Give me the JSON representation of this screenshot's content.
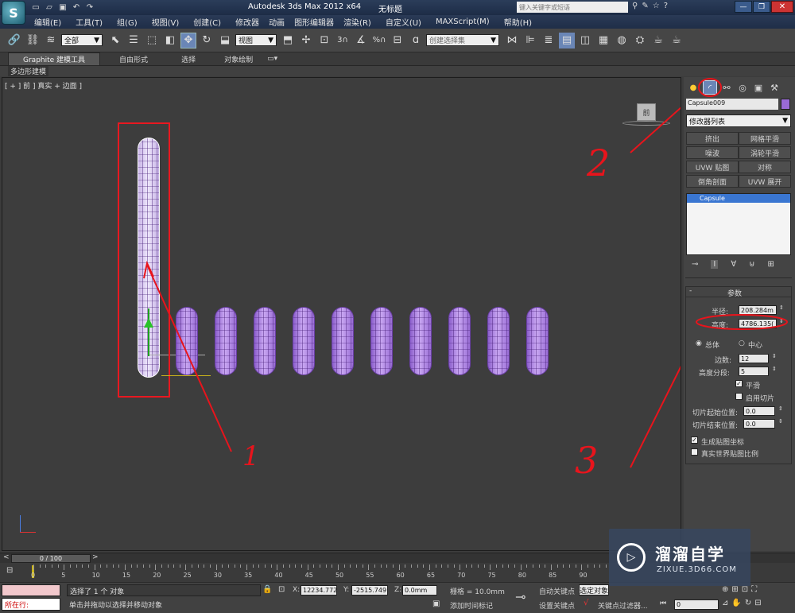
{
  "titlebar": {
    "app_title": "Autodesk 3ds Max  2012 x64",
    "doc_title": "无标题",
    "search_placeholder": "键入关键字或短语"
  },
  "menus": [
    "编辑(E)",
    "工具(T)",
    "组(G)",
    "视图(V)",
    "创建(C)",
    "修改器",
    "动画",
    "图形编辑器",
    "渲染(R)",
    "自定义(U)",
    "MAXScript(M)",
    "帮助(H)"
  ],
  "toolbar": {
    "selection_filter": "全部",
    "ref_coord": "视图",
    "named_selection": "创建选择集"
  },
  "ribbon": {
    "tabs": [
      "Graphite 建模工具",
      "自由形式",
      "选择",
      "对象绘制"
    ],
    "sub": "多边形建模"
  },
  "viewport": {
    "label": "[ + ] 前 ] 真实 + 边面 ]",
    "viewcube_label": "前"
  },
  "annotations": {
    "one": "1",
    "two": "2",
    "three": "3"
  },
  "command_panel": {
    "object_name": "Capsule009",
    "modifier_list": "修改器列表",
    "modifier_buttons": [
      "挤出",
      "网格平滑",
      "噪波",
      "涡轮平滑",
      "UVW 贴图",
      "对称",
      "倒角剖面",
      "UVW 展开"
    ],
    "stack_item": "Capsule",
    "rollout_title": "参数",
    "radius_label": "半径:",
    "radius_value": "208.284m",
    "height_label": "高度:",
    "height_value": "4786.135(",
    "overall_label": "总体",
    "center_label": "中心",
    "sides_label": "边数:",
    "sides_value": "12",
    "height_segs_label": "高度分段:",
    "height_segs_value": "5",
    "smooth_label": "平滑",
    "slice_on_label": "启用切片",
    "slice_from_label": "切片起始位置:",
    "slice_from_value": "0.0",
    "slice_to_label": "切片结束位置:",
    "slice_to_value": "0.0",
    "gen_map_label": "生成贴图坐标",
    "real_world_label": "真实世界贴图比例"
  },
  "timeline": {
    "frame_display": "0 / 100",
    "ticks": [
      "0",
      "5",
      "10",
      "15",
      "20",
      "25",
      "30",
      "35",
      "40",
      "45",
      "50",
      "55",
      "60",
      "65",
      "70",
      "75",
      "80",
      "85",
      "90"
    ]
  },
  "status": {
    "selection_info": "选择了 1 个 对象",
    "prompt": "单击并拖动以选择并移动对象",
    "x_label": "X:",
    "x_value": "12234.772",
    "y_label": "Y:",
    "y_value": "-2515.749",
    "z_label": "Z:",
    "z_value": "0.0mm",
    "grid": "栅格 = 10.0mm",
    "add_time_tag": "添加时间标记",
    "auto_key": "自动关键点",
    "selected": "选定对象",
    "set_key": "设置关键点",
    "key_filters": "关键点过滤器...",
    "frame_value": "0",
    "maxscript_label": "所在行:"
  },
  "watermark": {
    "brand": "溜溜自学",
    "url": "ZIXUE.3D66.COM"
  },
  "colors": {
    "capsule": "#b48ae6",
    "annotation_red": "#e8141c",
    "selection_box": "#e81820"
  }
}
